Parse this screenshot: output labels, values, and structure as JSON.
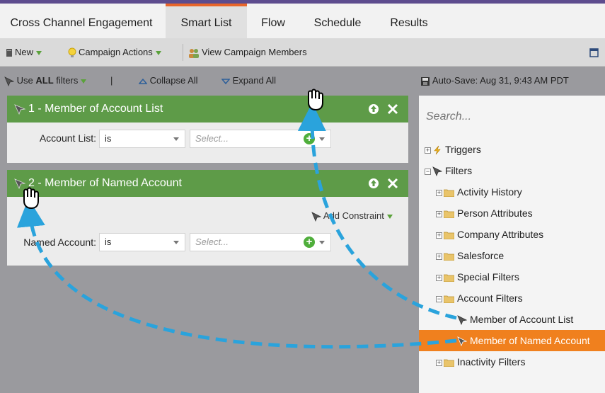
{
  "tabs": [
    {
      "label": "Cross Channel Engagement"
    },
    {
      "label": "Smart List"
    },
    {
      "label": "Flow"
    },
    {
      "label": "Schedule"
    },
    {
      "label": "Results"
    }
  ],
  "toolbar": {
    "new_label": "New",
    "campaign_actions_label": "Campaign Actions",
    "view_members_label": "View Campaign Members"
  },
  "filter_bar": {
    "use_label": "Use",
    "all_label": "ALL",
    "filters_label": "filters",
    "separator": "|",
    "collapse_label": "Collapse All",
    "expand_label": "Expand All"
  },
  "autosave": "Auto-Save: Aug 31, 9:43 AM PDT",
  "filters": [
    {
      "title": "1 - Member of Account List",
      "field_label": "Account List:",
      "operator": "is",
      "value_placeholder": "Select..."
    },
    {
      "title": "2 - Member of Named Account",
      "add_constraint": "Add Constraint",
      "field_label": "Named Account:",
      "operator": "is",
      "value_placeholder": "Select..."
    }
  ],
  "search": {
    "placeholder": "Search..."
  },
  "tree": {
    "triggers": "Triggers",
    "filters": "Filters",
    "activity_history": "Activity History",
    "person_attributes": "Person Attributes",
    "company_attributes": "Company Attributes",
    "salesforce": "Salesforce",
    "special_filters": "Special Filters",
    "account_filters": "Account Filters",
    "member_account_list": "Member of Account List",
    "member_named_account": "Member of Named Account",
    "inactivity_filters": "Inactivity Filters"
  },
  "colors": {
    "accent": "#5d4c8e",
    "tab_highlight": "#e8652a",
    "card_header": "#5e9b48",
    "selected_item": "#f0801e",
    "arrow": "#2aa3dc"
  }
}
